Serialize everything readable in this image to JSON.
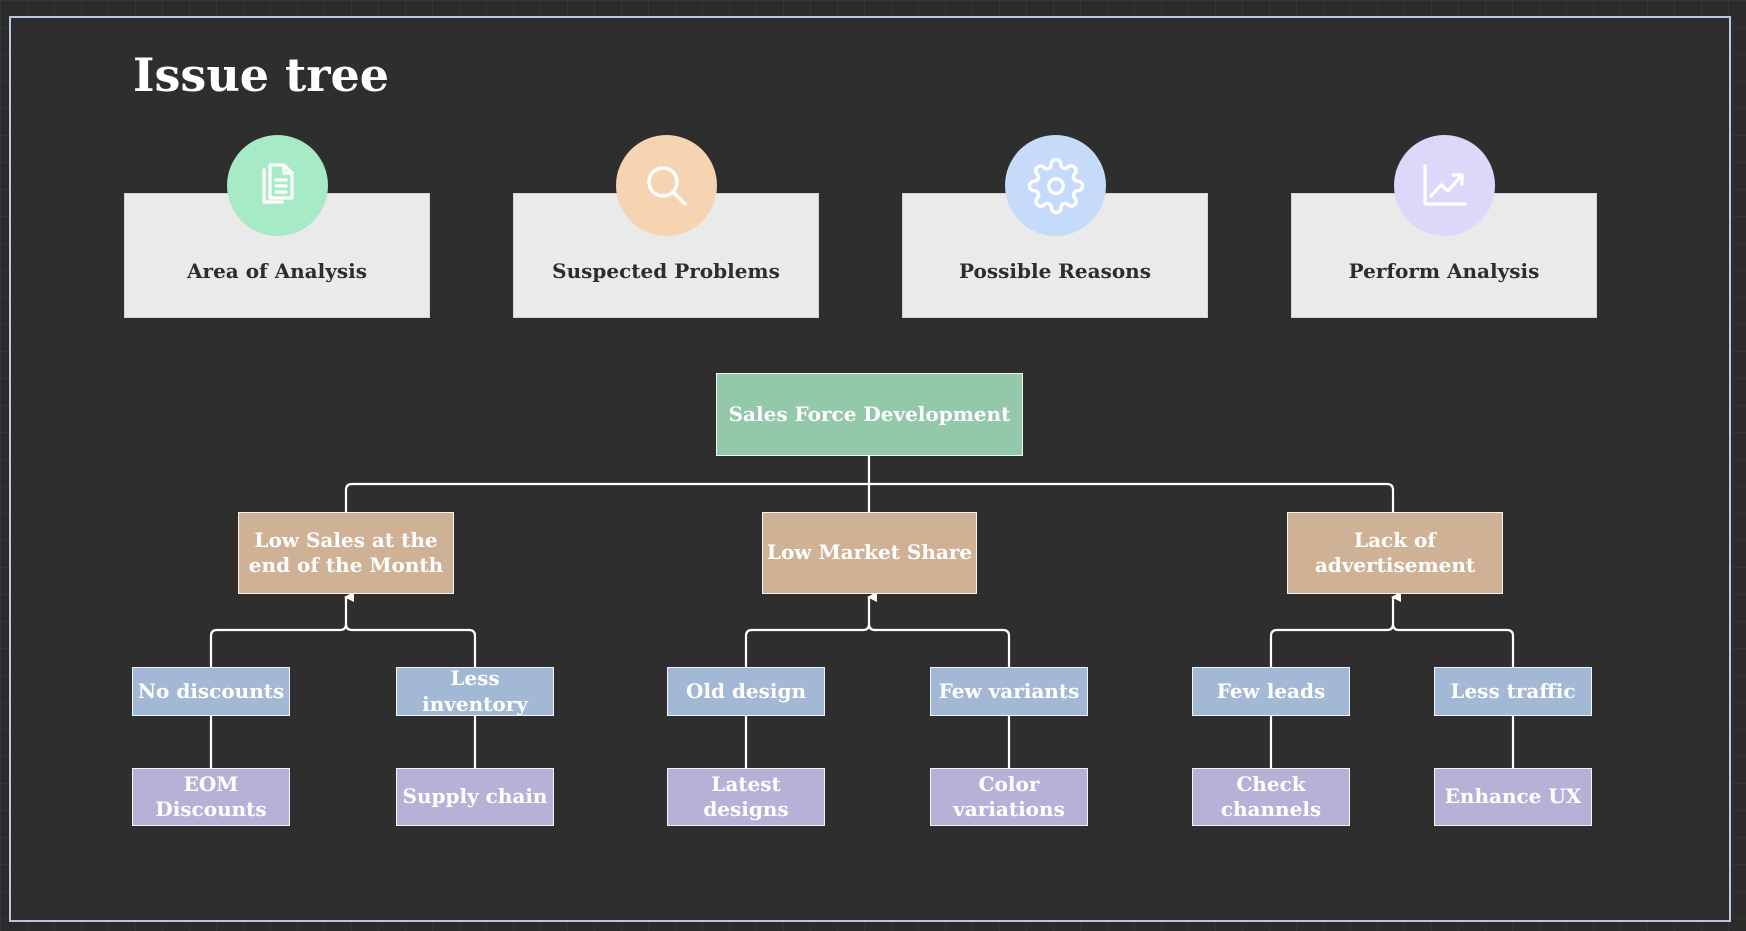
{
  "title": "Issue tree",
  "categories": [
    {
      "label": "Area of Analysis",
      "icon": "documents-icon",
      "color": "#a6ebc6"
    },
    {
      "label": "Suspected Problems",
      "icon": "search-icon",
      "color": "#f7d4b1"
    },
    {
      "label": "Possible Reasons",
      "icon": "gear-icon",
      "color": "#c6dafa"
    },
    {
      "label": "Perform Analysis",
      "icon": "chart-line-icon",
      "color": "#dcd8fa"
    }
  ],
  "tree": {
    "root": "Sales Force Development",
    "branches": [
      {
        "label": "Low Sales at the end of the Month",
        "causes": [
          {
            "label": "No discounts",
            "solution": "EOM Discounts"
          },
          {
            "label": "Less inventory",
            "solution": "Supply chain"
          }
        ]
      },
      {
        "label": "Low Market Share",
        "causes": [
          {
            "label": "Old design",
            "solution": "Latest designs"
          },
          {
            "label": "Few variants",
            "solution": "Color variations"
          }
        ]
      },
      {
        "label": "Lack of advertisement",
        "causes": [
          {
            "label": "Few leads",
            "solution": "Check channels"
          },
          {
            "label": "Less traffic",
            "solution": "Enhance UX"
          }
        ]
      }
    ]
  },
  "colors": {
    "root": "#93c8a8",
    "branch": "#cfb195",
    "cause": "#a3b8d5",
    "solution": "#b7b1d7",
    "connector": "#ffffff"
  }
}
